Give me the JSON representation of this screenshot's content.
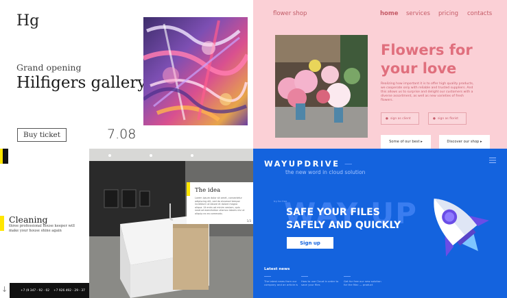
{
  "gallery": {
    "logo": "Hg",
    "kicker": "Grand opening",
    "title": "Hilfigers gallery",
    "ticket_label": "Buy ticket",
    "date": "7.08"
  },
  "flower": {
    "brand": "flower shop",
    "nav": [
      "home",
      "services",
      "pricing",
      "contacts"
    ],
    "headline_line1": "Flowers for",
    "headline_line2": "your love",
    "body": "Realizing how important it is to offer high quality products, we cooperate only with reliable and trusted suppliers. And this allows us to surprise and delight our customers with a diverse assortment, as well as new varieties of fresh flowers.",
    "pill_1": "sign as client",
    "pill_2": "sign as florist",
    "btn_1": "Some of our best ▸",
    "btn_2": "Discover our shop ▸",
    "accent": "#e06f7d",
    "background": "#fbd0d6"
  },
  "cleaning": {
    "title": "Cleaning",
    "subtitle": "three professional house keeper will make your house shine again",
    "phone_1": "+7 (9 347 - 92 - 02",
    "phone_2": "+7 926 492 - 29 - 37",
    "accent": "#ffe600"
  },
  "kitchen": {
    "card_title": "The idea",
    "card_text": "Lorem ipsum dolor sit amet, consectetur adipiscing elit, sed do eiusmod tempor incididunt ut labore et dolore magna aliqua. Ut enim ad minim veniam, quis nostrud exercitation ullamco laboris nisi ut aliquip ex ea commodo.",
    "pager": "1/3"
  },
  "wayupdrive": {
    "brand": "WAYUPDRIVE",
    "tagline": "the new word in cloud solution",
    "bg_word": "WAY UP",
    "small_label": "try for free",
    "headline_line1": "SAFE YOUR FILES",
    "headline_line2": "SAFELY AND QUICKLY",
    "signup_label": "Sign up",
    "latest_news": "Latest news",
    "news": [
      "The latest news from our company and an article is",
      "How to use Cloud in order to save your files",
      "Get for free our new solution for the Mac — product"
    ],
    "background": "#1463de"
  },
  "icons": {
    "menu": "hamburger-menu-icon",
    "rocket": "rocket-icon",
    "arrow": "arrow-down-icon"
  }
}
